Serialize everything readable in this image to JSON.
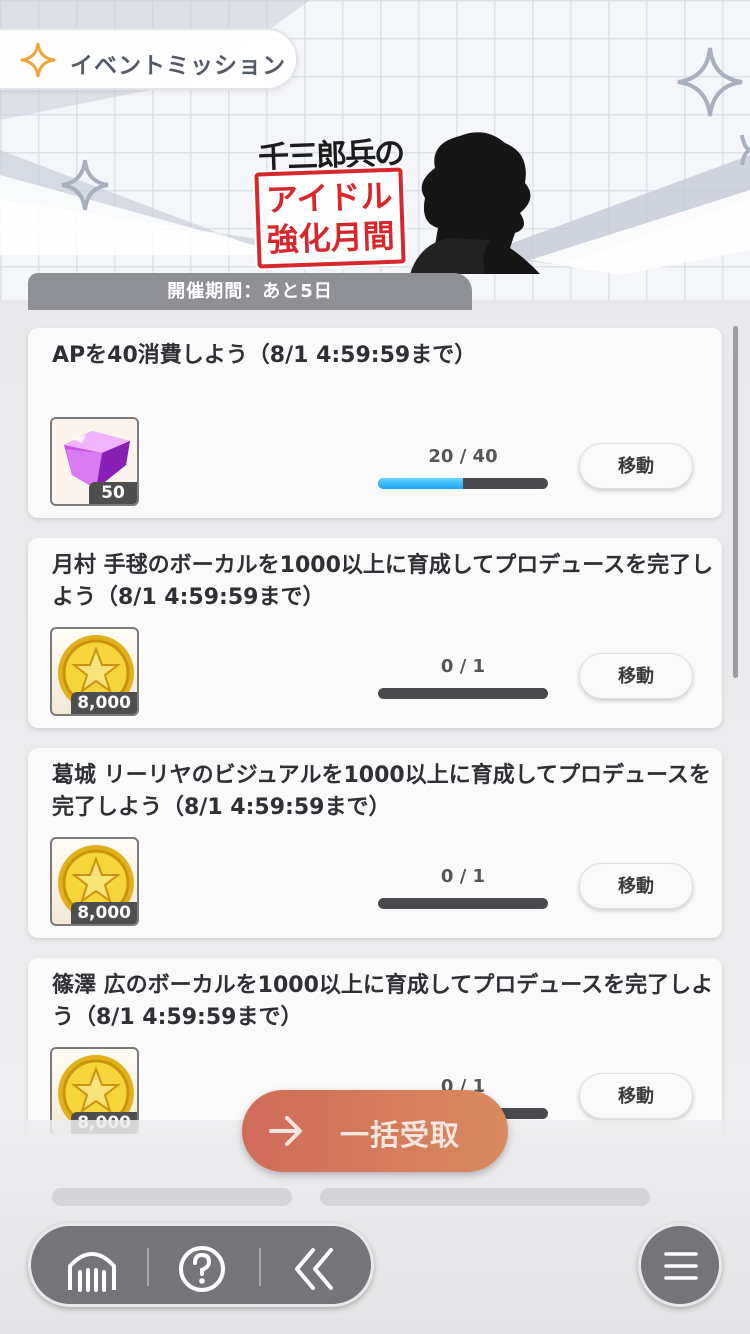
{
  "header": {
    "title": "イベントミッション"
  },
  "banner": {
    "brush_text": "千三郎兵の",
    "stamp_line1": "アイドル",
    "stamp_line2": "強化月間"
  },
  "period": {
    "text": "開催期間：あと5日"
  },
  "missions": [
    {
      "title": "APを40消費しよう（8/1 4:59:59まで）",
      "reward_icon": "gem-icon",
      "reward_qty": "50",
      "progress_text": "20 / 40",
      "progress_fraction": 0.5,
      "button_label": "移動"
    },
    {
      "title": "月村 手毬のボーカルを1000以上に育成してプロデュースを完了しよう（8/1 4:59:59まで）",
      "reward_icon": "coin-icon",
      "reward_qty": "8,000",
      "progress_text": "0 / 1",
      "progress_fraction": 0,
      "button_label": "移動"
    },
    {
      "title": "葛城 リーリヤのビジュアルを1000以上に育成してプロデュースを完了しよう（8/1 4:59:59まで）",
      "reward_icon": "coin-icon",
      "reward_qty": "8,000",
      "progress_text": "0 / 1",
      "progress_fraction": 0,
      "button_label": "移動"
    },
    {
      "title": "篠澤 広のボーカルを1000以上に育成してプロデュースを完了しよう（8/1 4:59:59まで）",
      "reward_icon": "coin-icon",
      "reward_qty": "8,000",
      "progress_text": "0 / 1",
      "progress_fraction": 0,
      "button_label": "移動"
    }
  ],
  "bulk_button": {
    "label": "一括受取",
    "icon": "arrow-right-icon"
  },
  "nav": {
    "home_icon": "home-icon",
    "help_icon": "help-icon",
    "back_icon": "back-double-chevron-icon",
    "menu_icon": "hamburger-menu-icon"
  },
  "colors": {
    "progress_fill": "#1aa4ef",
    "bulk_button": "#cf6b5a",
    "stamp_red": "#d6282c"
  }
}
